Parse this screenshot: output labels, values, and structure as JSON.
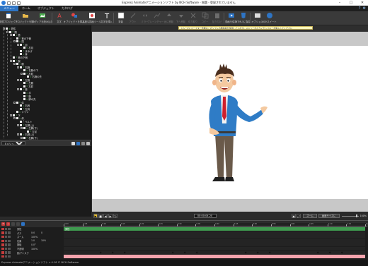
{
  "window": {
    "title": "Express Animateアニメ—ションソフト by NCH Software - 無題 - 登録されていません"
  },
  "menu": {
    "items": [
      "メニュー",
      "ホーム",
      "オブジェクト",
      "カタログ"
    ],
    "active_index": 1
  },
  "toolbar": {
    "buttons": [
      {
        "label": "新規プロジェクト",
        "icon": "new-project-icon",
        "enabled": true
      },
      {
        "label": "プロジェクトを開く",
        "icon": "open-folder-icon",
        "enabled": true
      },
      {
        "label": "メディアを読み込む",
        "icon": "import-media-icon",
        "enabled": true
      },
      {
        "label": "文字",
        "icon": "text-icon",
        "enabled": true
      },
      {
        "label": "オブジェクトを挿入",
        "icon": "insert-object-icon",
        "enabled": true
      },
      {
        "label": "高度な描画ツール",
        "icon": "advanced-draw-icon",
        "enabled": true
      },
      {
        "label": "文字を挿入",
        "icon": "insert-text-icon",
        "enabled": true
      },
      {
        "label": "背景",
        "icon": "background-icon",
        "enabled": true
      },
      {
        "label": "アウト",
        "icon": "fade-out-icon",
        "enabled": false
      },
      {
        "label": "ミラー",
        "icon": "mirror-icon",
        "enabled": false
      },
      {
        "label": "ブレーンチャート",
        "icon": "chart-icon",
        "enabled": false
      },
      {
        "label": "上に移動",
        "icon": "move-up-icon",
        "enabled": false
      },
      {
        "label": "下へ移動",
        "icon": "move-down-icon",
        "enabled": false
      },
      {
        "label": "切り取り",
        "icon": "cut-icon",
        "enabled": false
      },
      {
        "label": "コピー",
        "icon": "copy-icon",
        "enabled": false
      },
      {
        "label": "貼り付け",
        "icon": "paste-icon",
        "enabled": false
      },
      {
        "label": "動画を保存",
        "icon": "save-video-icon",
        "enabled": true
      },
      {
        "label": "HTML5に保存",
        "icon": "html5-icon",
        "enabled": true
      },
      {
        "label": "オプション",
        "icon": "options-icon",
        "enabled": true
      },
      {
        "label": "NCHスイート",
        "icon": "nch-suite-icon",
        "enabled": true
      }
    ]
  },
  "tree": {
    "rows": [
      {
        "label": "男性",
        "glyph": "bone",
        "depth": 0,
        "exp": "-"
      },
      {
        "label": "頭",
        "glyph": "bone",
        "depth": 1,
        "exp": "-"
      },
      {
        "label": "首",
        "glyph": "bone",
        "depth": 2,
        "exp": "-"
      },
      {
        "label": "首の下側",
        "glyph": "bone",
        "depth": 3,
        "exp": ""
      },
      {
        "label": "頭",
        "glyph": "bone",
        "depth": 3,
        "exp": "-"
      },
      {
        "label": "目",
        "glyph": "bone",
        "depth": 4,
        "exp": "-"
      },
      {
        "label": "右目",
        "glyph": "bone",
        "depth": 5,
        "exp": ""
      },
      {
        "label": "まゆげ",
        "glyph": "bone",
        "depth": 4,
        "exp": ""
      },
      {
        "label": "耳",
        "glyph": "bone",
        "depth": 4,
        "exp": ""
      },
      {
        "label": "首の下側",
        "glyph": "bone",
        "depth": 2,
        "exp": ""
      },
      {
        "label": "腕",
        "glyph": "bone",
        "depth": 2,
        "exp": "-"
      },
      {
        "label": "腕",
        "glyph": "bone",
        "depth": 3,
        "exp": "-"
      },
      {
        "label": "右腕",
        "glyph": "bone",
        "depth": 4,
        "exp": "-"
      },
      {
        "label": "右腕の下",
        "glyph": "bone",
        "depth": 5,
        "exp": ""
      },
      {
        "label": "右肘",
        "glyph": "bone",
        "depth": 5,
        "exp": "-"
      },
      {
        "label": "右腕の先",
        "glyph": "bone",
        "depth": 6,
        "exp": ""
      },
      {
        "label": "左腕",
        "glyph": "bone",
        "depth": 4,
        "exp": "-"
      },
      {
        "label": "左腕",
        "glyph": "bone",
        "depth": 5,
        "exp": ""
      },
      {
        "label": "左肘",
        "glyph": "bone",
        "depth": 5,
        "exp": ""
      },
      {
        "label": "首",
        "glyph": "bone",
        "depth": 4,
        "exp": "-"
      },
      {
        "label": "手",
        "glyph": "bone",
        "depth": 5,
        "exp": ""
      },
      {
        "label": "腕",
        "glyph": "bone",
        "depth": 5,
        "exp": ""
      },
      {
        "label": "脚の先",
        "glyph": "bone",
        "depth": 5,
        "exp": ""
      },
      {
        "label": "体",
        "glyph": "bone",
        "depth": 3,
        "exp": "-"
      },
      {
        "label": "右肩",
        "glyph": "bone",
        "depth": 4,
        "exp": ""
      },
      {
        "label": "左肩",
        "glyph": "bone",
        "depth": 4,
        "exp": ""
      },
      {
        "label": "シャツ",
        "glyph": "bone",
        "depth": 3,
        "exp": ""
      },
      {
        "label": "下",
        "glyph": "bone",
        "depth": 2,
        "exp": "-"
      },
      {
        "label": "体",
        "glyph": "bone",
        "depth": 3,
        "exp": "-"
      },
      {
        "label": "ベルト",
        "glyph": "line",
        "depth": 4,
        "exp": ""
      },
      {
        "label": "左脚(上)",
        "glyph": "bone",
        "depth": 4,
        "exp": "-"
      },
      {
        "label": "左脚(下)",
        "glyph": "bone",
        "depth": 5,
        "exp": "-"
      },
      {
        "label": "左足",
        "glyph": "bone",
        "depth": 6,
        "exp": ""
      },
      {
        "label": "右脚(上)",
        "glyph": "bone",
        "depth": 4,
        "exp": "-"
      },
      {
        "label": "右脚(下)",
        "glyph": "bone",
        "depth": 5,
        "exp": "-"
      }
    ]
  },
  "properties": {
    "selector_value": "Eメソッド",
    "rows": [
      {
        "label": "パス",
        "v1": "0:0",
        "v2": "0"
      },
      {
        "label": "ズーム",
        "v1": "100%",
        "v2": ""
      },
      {
        "label": "位置",
        "v1": "1.0",
        "v2": "10%"
      },
      {
        "label": "回転",
        "v1": "0.0°",
        "v2": ""
      },
      {
        "label": "不透明",
        "v1": "100%",
        "v2": ""
      },
      {
        "label": "影",
        "v1": "",
        "v2": ""
      },
      {
        "label": "前景/背景",
        "v1": "",
        "v2": ""
      }
    ]
  },
  "canvas": {
    "banner_text": "スムーズにペースター作業はこのソフトの無料版を使用しています。メニューからライセンスキーを購入してください"
  },
  "transport": {
    "timecode": "00:00:04.20",
    "buttons": [
      "play",
      "stop",
      "prev",
      "next",
      "loop"
    ],
    "right_buttons": [
      "ズーム",
      "画面サイズに"
    ],
    "zoom_value": "100%"
  },
  "timeline": {
    "ruler_labels": [
      "0:00",
      "0:05",
      "0:10",
      "0:15",
      "0:20",
      "0:25",
      "0:30",
      "0:35",
      "0:40",
      "0:45",
      "0:50",
      "0:55",
      "1:00",
      "1:05",
      "1:10",
      "1:15",
      "1:20"
    ],
    "rows": [
      {
        "label": "男性",
        "v1": "",
        "v2": "",
        "style": "green-header"
      },
      {
        "label": "パス",
        "v1": "0:0",
        "v2": "0",
        "style": "dark"
      },
      {
        "label": "ズーム",
        "v1": "100%",
        "v2": "",
        "style": "dark"
      },
      {
        "label": "位置",
        "v1": "1.0",
        "v2": "10%",
        "style": "dark"
      },
      {
        "label": "回転",
        "v1": "0.0°",
        "v2": "",
        "style": "dark"
      },
      {
        "label": "不透明",
        "v1": "100%",
        "v2": "",
        "style": "dark"
      },
      {
        "label": "影/ディスク",
        "v1": "",
        "v2": "",
        "style": "dark"
      },
      {
        "label": "",
        "v1": "",
        "v2": "",
        "style": "pink"
      }
    ],
    "keyframes_row6": [
      0.12,
      0.16,
      0.2,
      0.36,
      0.4,
      0.44,
      0.6,
      0.64,
      0.68,
      0.84,
      0.88,
      0.92
    ]
  },
  "status": {
    "text": "Express Animateアニメ—ションソフト v 4.16 © NCH Software"
  },
  "colors": {
    "accent": "#2e74c4",
    "bone_green": "#5fd35f",
    "timeline_green": "#3f9a4f",
    "timeline_pink": "#f4a3ad",
    "tag_red": "#c43b3b",
    "play_yellow": "#e8c030"
  }
}
